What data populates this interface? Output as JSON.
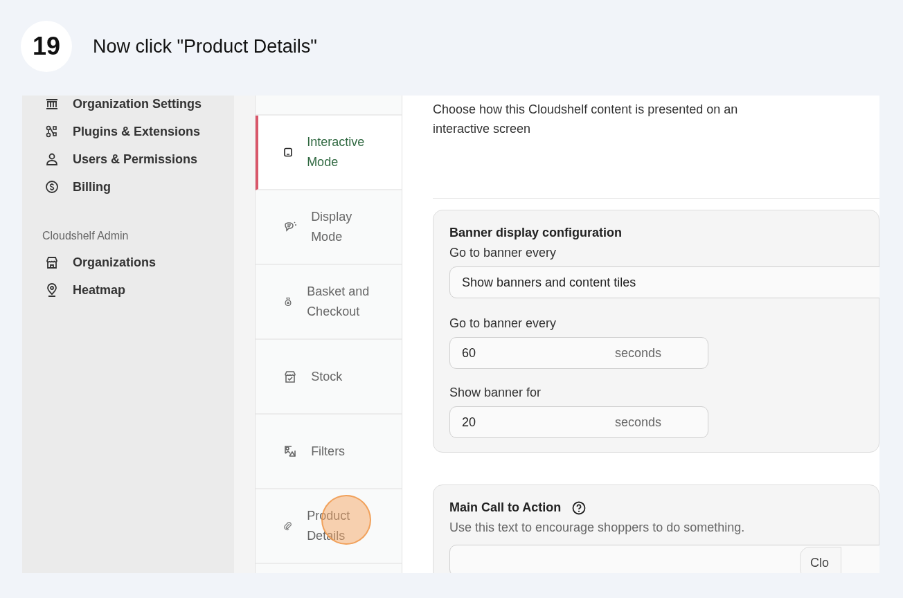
{
  "step": {
    "number": "19",
    "instruction": "Now click \"Product Details\""
  },
  "sidebar": {
    "groups": [
      {
        "items": [
          {
            "label": "Organization Settings"
          },
          {
            "label": "Plugins & Extensions"
          },
          {
            "label": "Users & Permissions"
          },
          {
            "label": "Billing"
          }
        ]
      },
      {
        "heading": "Cloudshelf Admin",
        "items": [
          {
            "label": "Organizations"
          },
          {
            "label": "Heatmap"
          }
        ]
      }
    ]
  },
  "tabs": [
    {
      "label": "Interactive Mode",
      "selected": true,
      "click_marker": false
    },
    {
      "label": "Display Mode",
      "selected": false,
      "click_marker": false
    },
    {
      "label": "Basket and Checkout",
      "selected": false,
      "click_marker": false
    },
    {
      "label": "Stock",
      "selected": false,
      "click_marker": false
    },
    {
      "label": "Filters",
      "selected": false,
      "click_marker": false
    },
    {
      "label": "Product Details",
      "selected": false,
      "click_marker": true
    }
  ],
  "content": {
    "description": "Choose how this Cloudshelf content is presented on an interactive screen",
    "cards": [
      {
        "title": "Banner display configuration",
        "help_icon": false,
        "fields": [
          {
            "kind": "select",
            "label": "Go to banner every",
            "value": "Show banners and content tiles"
          },
          {
            "kind": "number",
            "label": "Go to banner every",
            "value": "60",
            "unit": "seconds"
          },
          {
            "kind": "number",
            "label": "Show banner for",
            "value": "20",
            "unit": "seconds"
          }
        ]
      },
      {
        "title": "Main Call to Action",
        "help_icon": true,
        "description": "Use this text to encourage shoppers to do something.",
        "fields": [
          {
            "kind": "text"
          }
        ]
      }
    ]
  },
  "floating_button": {
    "label": "Clo"
  }
}
